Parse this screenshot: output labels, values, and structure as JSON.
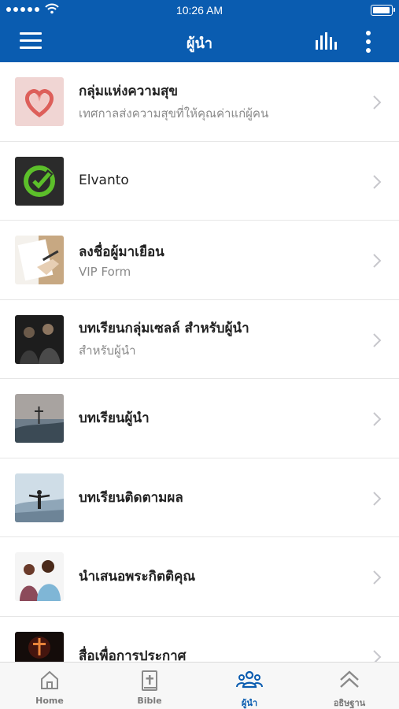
{
  "status_bar": {
    "time": "10:26 AM"
  },
  "nav": {
    "title": "ผู้นำ"
  },
  "items": [
    {
      "title": "กลุ่มแห่งความสุข",
      "subtitle": "เทศกาลส่งความสุขที่ให้คุณค่าแก่ผู้คน",
      "thumb": "heart"
    },
    {
      "title": "Elvanto",
      "subtitle": "",
      "thumb": "elvanto"
    },
    {
      "title": "ลงชื่อผู้มาเยือน",
      "subtitle": "VIP Form",
      "thumb": "writing"
    },
    {
      "title": "บทเรียนกลุ่มเซลล์ สำหรับผู้นำ",
      "subtitle": "สำหรับผู้นำ",
      "thumb": "group"
    },
    {
      "title": "บทเรียนผู้นำ",
      "subtitle": "",
      "thumb": "cross-landscape"
    },
    {
      "title": "บทเรียนติดตามผล",
      "subtitle": "",
      "thumb": "person-mountain"
    },
    {
      "title": "นำเสนอพระกิตติคุณ",
      "subtitle": "",
      "thumb": "two-women"
    },
    {
      "title": "สื่อเพื่อการประกาศ",
      "subtitle": "",
      "thumb": "dark-cross"
    }
  ],
  "tabs": [
    {
      "label": "Home",
      "icon": "home-icon"
    },
    {
      "label": "Bible",
      "icon": "bible-icon"
    },
    {
      "label": "ผู้นำ",
      "icon": "people-icon",
      "active": true
    },
    {
      "label": "อธิษฐาน",
      "icon": "chevrons-up-icon"
    }
  ],
  "colors": {
    "primary": "#0a5cb0",
    "tab_bar": "#f7f7f7"
  }
}
